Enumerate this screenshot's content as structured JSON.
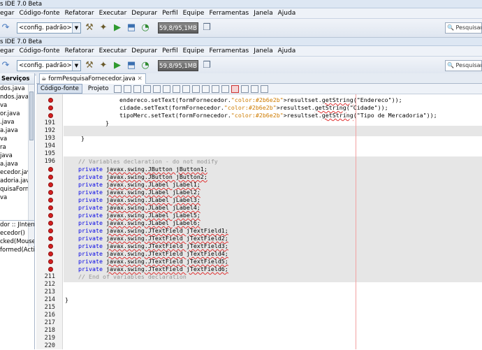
{
  "window1": {
    "title": "s IDE 7.0 Beta",
    "menu": [
      "egar",
      "Código-fonte",
      "Refatorar",
      "Executar",
      "Depurar",
      "Perfil",
      "Equipe",
      "Ferramentas",
      "Janela",
      "Ajuda"
    ],
    "config": "<config. padrão>",
    "memory": "59,8/95,1MB",
    "search": "Pesquisar"
  },
  "window2": {
    "title": "s IDE 7.0 Beta",
    "menu": [
      "egar",
      "Código-fonte",
      "Refatorar",
      "Executar",
      "Depurar",
      "Perfil",
      "Equipe",
      "Ferramentas",
      "Janela",
      "Ajuda"
    ],
    "config": "<config. padrão>",
    "memory": "59,8/95,1MB",
    "search": "Pesquisar"
  },
  "side": {
    "header": "Serviços",
    "files": [
      "dos.java",
      "ndos.java",
      "va",
      "or.java",
      "",
      ".java",
      "a.java",
      "va",
      "ra",
      "java",
      "a.java",
      "ecedor.java",
      "adoria.java",
      "quisaFornecedor",
      "va"
    ],
    "nav": [
      "dor :: JInternalF",
      "ecedor()",
      "",
      "",
      "cked(MouseEven",
      "formed(ActionE"
    ]
  },
  "editor": {
    "tab": "formPesquisaFornecedor.java",
    "source_btn": "Código-fonte",
    "design_btn": "Projeto",
    "lines": [
      {
        "n": "",
        "err": true,
        "t": "endereco.setText(formFornecedor.resultset.getString(\"Endereco\"));"
      },
      {
        "n": "",
        "err": true,
        "t": "cidade.setText(formFornecedor.resultset.getString(\"Cidade\"));"
      },
      {
        "n": "",
        "err": true,
        "t": "tipoMerc.setText(formFornecedor.resultset.getString(\"Tipo de Mercadoria\"));"
      },
      {
        "n": "191",
        "err": false,
        "t": "}"
      },
      {
        "n": "192",
        "err": false,
        "t": ""
      },
      {
        "n": "193",
        "err": false,
        "t": "}"
      },
      {
        "n": "194",
        "err": false,
        "t": ""
      },
      {
        "n": "195",
        "err": false,
        "t": ""
      },
      {
        "n": "196",
        "err": false,
        "t": "// Variables declaration - do not modify"
      },
      {
        "n": "",
        "err": true,
        "t": "private javax.swing.JButton jButton1;"
      },
      {
        "n": "",
        "err": true,
        "t": "private javax.swing.JButton jButton2;"
      },
      {
        "n": "",
        "err": true,
        "t": "private javax.swing.JLabel jLabel1;"
      },
      {
        "n": "",
        "err": true,
        "t": "private javax.swing.JLabel jLabel2;"
      },
      {
        "n": "",
        "err": true,
        "t": "private javax.swing.JLabel jLabel3;"
      },
      {
        "n": "",
        "err": true,
        "t": "private javax.swing.JLabel jLabel4;"
      },
      {
        "n": "",
        "err": true,
        "t": "private javax.swing.JLabel jLabel5;"
      },
      {
        "n": "",
        "err": true,
        "t": "private javax.swing.JLabel jLabel6;"
      },
      {
        "n": "",
        "err": true,
        "t": "private javax.swing.JTextField jTextField1;"
      },
      {
        "n": "",
        "err": true,
        "t": "private javax.swing.JTextField jTextField2;"
      },
      {
        "n": "",
        "err": true,
        "t": "private javax.swing.JTextField jTextField3;"
      },
      {
        "n": "",
        "err": true,
        "t": "private javax.swing.JTextField jTextField4;"
      },
      {
        "n": "",
        "err": true,
        "t": "private javax.swing.JTextField jTextField5;"
      },
      {
        "n": "",
        "err": true,
        "t": "private javax.swing.JTextField jTextField6;"
      },
      {
        "n": "211",
        "err": false,
        "t": "// End of variables declaration"
      },
      {
        "n": "212",
        "err": false,
        "t": ""
      },
      {
        "n": "213",
        "err": false,
        "t": ""
      },
      {
        "n": "214",
        "err": false,
        "t": "}"
      },
      {
        "n": "215",
        "err": false,
        "t": ""
      },
      {
        "n": "216",
        "err": false,
        "t": ""
      },
      {
        "n": "217",
        "err": false,
        "t": ""
      },
      {
        "n": "218",
        "err": false,
        "t": ""
      },
      {
        "n": "219",
        "err": false,
        "t": ""
      },
      {
        "n": "220",
        "err": false,
        "t": ""
      }
    ]
  },
  "colors": {
    "error": "#d42020",
    "keyword": "#0000e6",
    "string": "#ce7b00",
    "comment": "#969696",
    "highlight": "#e6e6e6"
  }
}
